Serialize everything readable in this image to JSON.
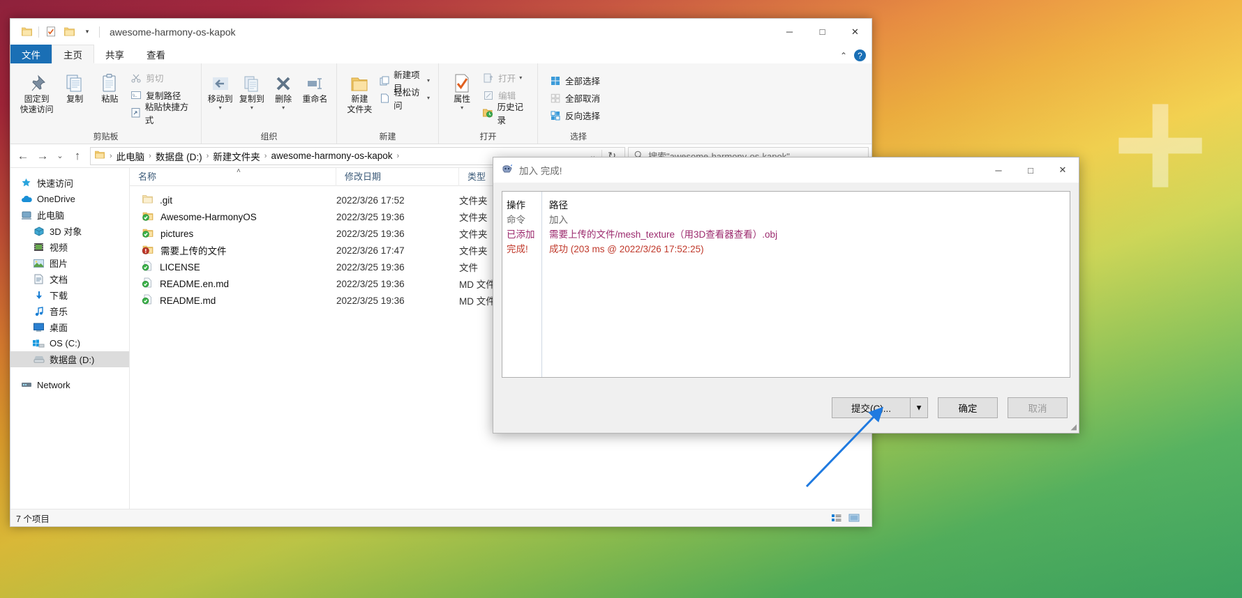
{
  "window": {
    "title": "awesome-harmony-os-kapok",
    "quick_access_icons": [
      "folder-icon",
      "properties-icon",
      "new-folder-icon",
      "customize-qat-caret"
    ],
    "controls": {
      "minimize": "─",
      "maximize": "□",
      "close": "✕"
    }
  },
  "tabs": [
    {
      "label": "文件",
      "name": "tab-file"
    },
    {
      "label": "主页",
      "name": "tab-home"
    },
    {
      "label": "共享",
      "name": "tab-share"
    },
    {
      "label": "查看",
      "name": "tab-view"
    }
  ],
  "ribbon": {
    "help_label": "?",
    "groups": [
      {
        "label": "剪贴板",
        "big": [
          {
            "label": "固定到\n快速访问",
            "line1": "固定到",
            "line2": "快速访问",
            "icon": "pin-icon"
          },
          {
            "line1": "复制",
            "line2": "",
            "icon": "copy-icon"
          },
          {
            "line1": "粘贴",
            "line2": "",
            "icon": "paste-icon"
          }
        ],
        "small": [
          {
            "label": "剪切",
            "icon": "scissors-icon",
            "disabled": true
          },
          {
            "label": "复制路径",
            "icon": "copy-path-icon",
            "disabled": false
          },
          {
            "label": "粘贴快捷方式",
            "icon": "paste-shortcut-icon",
            "disabled": false
          }
        ]
      },
      {
        "label": "组织",
        "big": [
          {
            "line1": "移动到",
            "line2": "",
            "icon": "move-to-icon",
            "caret": true,
            "disabled": true
          },
          {
            "line1": "复制到",
            "line2": "",
            "icon": "copy-to-icon",
            "caret": true,
            "disabled": true
          },
          {
            "line1": "删除",
            "line2": "",
            "icon": "delete-icon",
            "caret": true
          },
          {
            "line1": "重命名",
            "line2": "",
            "icon": "rename-icon",
            "disabled": true
          }
        ],
        "small": []
      },
      {
        "label": "新建",
        "big": [
          {
            "line1": "新建",
            "line2": "文件夹",
            "icon": "new-folder-icon"
          }
        ],
        "small": [
          {
            "label": "新建项目",
            "icon": "new-item-icon",
            "caret": true
          },
          {
            "label": "轻松访问",
            "icon": "easy-access-icon",
            "caret": true
          }
        ]
      },
      {
        "label": "打开",
        "big": [
          {
            "line1": "属性",
            "line2": "",
            "icon": "properties-icon",
            "caret": true
          }
        ],
        "small": [
          {
            "label": "打开",
            "icon": "open-icon",
            "caret": true,
            "disabled": true
          },
          {
            "label": "编辑",
            "icon": "edit-icon",
            "disabled": true
          },
          {
            "label": "历史记录",
            "icon": "history-icon",
            "disabled": false
          }
        ]
      },
      {
        "label": "选择",
        "big": [],
        "small": [
          {
            "label": "全部选择",
            "icon": "select-all-icon"
          },
          {
            "label": "全部取消",
            "icon": "select-none-icon"
          },
          {
            "label": "反向选择",
            "icon": "invert-selection-icon"
          }
        ]
      }
    ]
  },
  "addressbar": {
    "back": "←",
    "forward": "→",
    "recent_caret": "⌄",
    "up": "↑",
    "crumbs": [
      "此电脑",
      "数据盘 (D:)",
      "新建文件夹",
      "awesome-harmony-os-kapok"
    ],
    "separator": "›",
    "dropdown_caret": "⌄",
    "refresh": "↻",
    "search_placeholder": "搜索\"awesome-harmony-os-kapok\""
  },
  "navpane": {
    "items": [
      {
        "label": "快速访问",
        "icon": "star-pin-icon",
        "indent": false,
        "selected": false
      },
      {
        "label": "OneDrive",
        "icon": "onedrive-cloud-icon",
        "indent": false,
        "selected": false
      },
      {
        "label": "此电脑",
        "icon": "this-pc-icon",
        "indent": false,
        "selected": false
      },
      {
        "label": "3D 对象",
        "icon": "3d-objects-icon",
        "indent": true,
        "selected": false
      },
      {
        "label": "视频",
        "icon": "videos-icon",
        "indent": true,
        "selected": false
      },
      {
        "label": "图片",
        "icon": "pictures-icon",
        "indent": true,
        "selected": false
      },
      {
        "label": "文档",
        "icon": "documents-icon",
        "indent": true,
        "selected": false
      },
      {
        "label": "下载",
        "icon": "downloads-icon",
        "indent": true,
        "selected": false
      },
      {
        "label": "音乐",
        "icon": "music-icon",
        "indent": true,
        "selected": false
      },
      {
        "label": "桌面",
        "icon": "desktop-icon",
        "indent": true,
        "selected": false
      },
      {
        "label": "OS (C:)",
        "icon": "windows-drive-icon",
        "indent": true,
        "selected": false
      },
      {
        "label": "数据盘 (D:)",
        "icon": "drive-icon",
        "indent": true,
        "selected": true
      },
      {
        "label": "Network",
        "icon": "network-icon",
        "indent": false,
        "selected": false
      }
    ]
  },
  "filelist": {
    "columns": [
      "名称",
      "修改日期",
      "类型"
    ],
    "sort_indicator": "˄",
    "rows": [
      {
        "name": ".git",
        "date": "2022/3/26 17:52",
        "type": "文件夹",
        "icon": "folder-plain-icon"
      },
      {
        "name": "Awesome-HarmonyOS",
        "date": "2022/3/25 19:36",
        "type": "文件夹",
        "icon": "folder-synced-icon"
      },
      {
        "name": "pictures",
        "date": "2022/3/25 19:36",
        "type": "文件夹",
        "icon": "folder-synced-icon"
      },
      {
        "name": "需要上传的文件",
        "date": "2022/3/26 17:47",
        "type": "文件夹",
        "icon": "folder-error-icon"
      },
      {
        "name": "LICENSE",
        "date": "2022/3/25 19:36",
        "type": "文件",
        "icon": "file-synced-icon"
      },
      {
        "name": "README.en.md",
        "date": "2022/3/25 19:36",
        "type": "MD 文件",
        "icon": "file-synced-icon"
      },
      {
        "name": "README.md",
        "date": "2022/3/25 19:36",
        "type": "MD 文件",
        "icon": "file-synced-icon"
      }
    ]
  },
  "statusbar": {
    "count_text": "7 个项目",
    "view_details_icon": "details-view-icon",
    "view_large_icon": "large-icons-view-icon"
  },
  "dialog": {
    "title": "加入 完成!",
    "icon": "winrar-icon",
    "controls": {
      "minimize": "─",
      "maximize": "□",
      "close": "✕"
    },
    "log": {
      "header": {
        "op": "操作",
        "path": "路径"
      },
      "rows": [
        {
          "op": "命令",
          "path": "加入",
          "color": "#6b6b6b"
        },
        {
          "op": "已添加",
          "path": "需要上传的文件/mesh_texture（用3D查看器查看）.obj",
          "color": "#9c2b6e"
        },
        {
          "op": "完成!",
          "path": "成功 (203 ms @ 2022/3/26 17:52:25)",
          "color": "#c0392b"
        }
      ]
    },
    "buttons": [
      {
        "label": "提交(C)...",
        "name": "submit-button",
        "split": true,
        "disabled": false
      },
      {
        "label": "确定",
        "name": "ok-button",
        "split": false,
        "disabled": false
      },
      {
        "label": "取消",
        "name": "cancel-button",
        "split": false,
        "disabled": true
      }
    ],
    "split_caret": "▾"
  },
  "colors": {
    "accent": "#1a6fb5",
    "selection": "#dcdcdc",
    "log_added": "#9c2b6e",
    "log_done": "#c0392b",
    "arrow": "#1f7ae0"
  }
}
